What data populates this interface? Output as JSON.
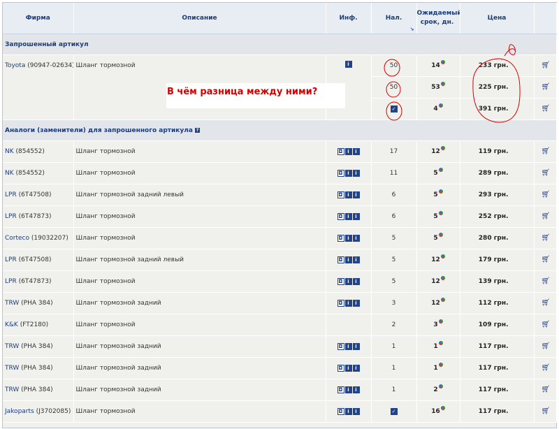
{
  "headers": {
    "firm": "Фирма",
    "description": "Описание",
    "info": "Инф.",
    "stock": "Нал.",
    "term": "Ожидаемый срок, дн.",
    "price": "Цена"
  },
  "requested": {
    "section_title": "Запрошенный артикул",
    "firm": "Toyota",
    "code": "(90947-02634)",
    "description": "Шланг тормозной",
    "offers": [
      {
        "stock": "50",
        "term": "14",
        "price": "233 грн."
      },
      {
        "stock": "50",
        "term": "53",
        "price": "225 грн."
      },
      {
        "stock": "",
        "term": "4",
        "price": "391 грн."
      }
    ]
  },
  "annotation": "В чём разница между ними?",
  "analogs": {
    "section_title": "Аналоги (заменители) для запрошенного артикула",
    "rows": [
      {
        "firm": "NK",
        "code": "(854552)",
        "description": "Шланг тормозной",
        "stock": "17",
        "term": "12",
        "price": "119 грн."
      },
      {
        "firm": "NK",
        "code": "(854552)",
        "description": "Шланг тормозной",
        "stock": "11",
        "term": "5",
        "price": "289 грн."
      },
      {
        "firm": "LPR",
        "code": "(6T47508)",
        "description": "Шланг тормозной задний левый",
        "stock": "6",
        "term": "5",
        "price": "293 грн."
      },
      {
        "firm": "LPR",
        "code": "(6T47873)",
        "description": "Шланг тормозной",
        "stock": "6",
        "term": "5",
        "price": "252 грн."
      },
      {
        "firm": "Corteco",
        "code": "(19032207)",
        "description": "Шланг тормозной",
        "stock": "5",
        "term": "5",
        "price": "280 грн."
      },
      {
        "firm": "LPR",
        "code": "(6T47508)",
        "description": "Шланг тормозной задний левый",
        "stock": "5",
        "term": "12",
        "price": "179 грн."
      },
      {
        "firm": "LPR",
        "code": "(6T47873)",
        "description": "Шланг тормозной",
        "stock": "5",
        "term": "12",
        "price": "139 грн."
      },
      {
        "firm": "TRW",
        "code": "(PHA 384)",
        "description": "Шланг тормозной задний",
        "stock": "3",
        "term": "12",
        "price": "112 грн."
      },
      {
        "firm": "K&K",
        "code": "(FT2180)",
        "description": "Шланг тормозной",
        "stock": "2",
        "term": "3",
        "price": "109 грн."
      },
      {
        "firm": "TRW",
        "code": "(PHA 384)",
        "description": "Шланг тормозной задний",
        "stock": "1",
        "term": "1",
        "price": "117 грн."
      },
      {
        "firm": "TRW",
        "code": "(PHA 384)",
        "description": "Шланг тормозной задний",
        "stock": "1",
        "term": "1",
        "price": "117 грн."
      },
      {
        "firm": "TRW",
        "code": "(PHA 384)",
        "description": "Шланг тормозной задний",
        "stock": "1",
        "term": "2",
        "price": "117 грн."
      },
      {
        "firm": "Jakoparts",
        "code": "(J3702085)",
        "description": "Шланг тормозной",
        "stock": "",
        "term": "16",
        "price": "117 грн."
      }
    ]
  },
  "colors": {
    "link": "#1a3d7c",
    "annotation": "#d40000",
    "header_bg": "#e8edf4"
  }
}
